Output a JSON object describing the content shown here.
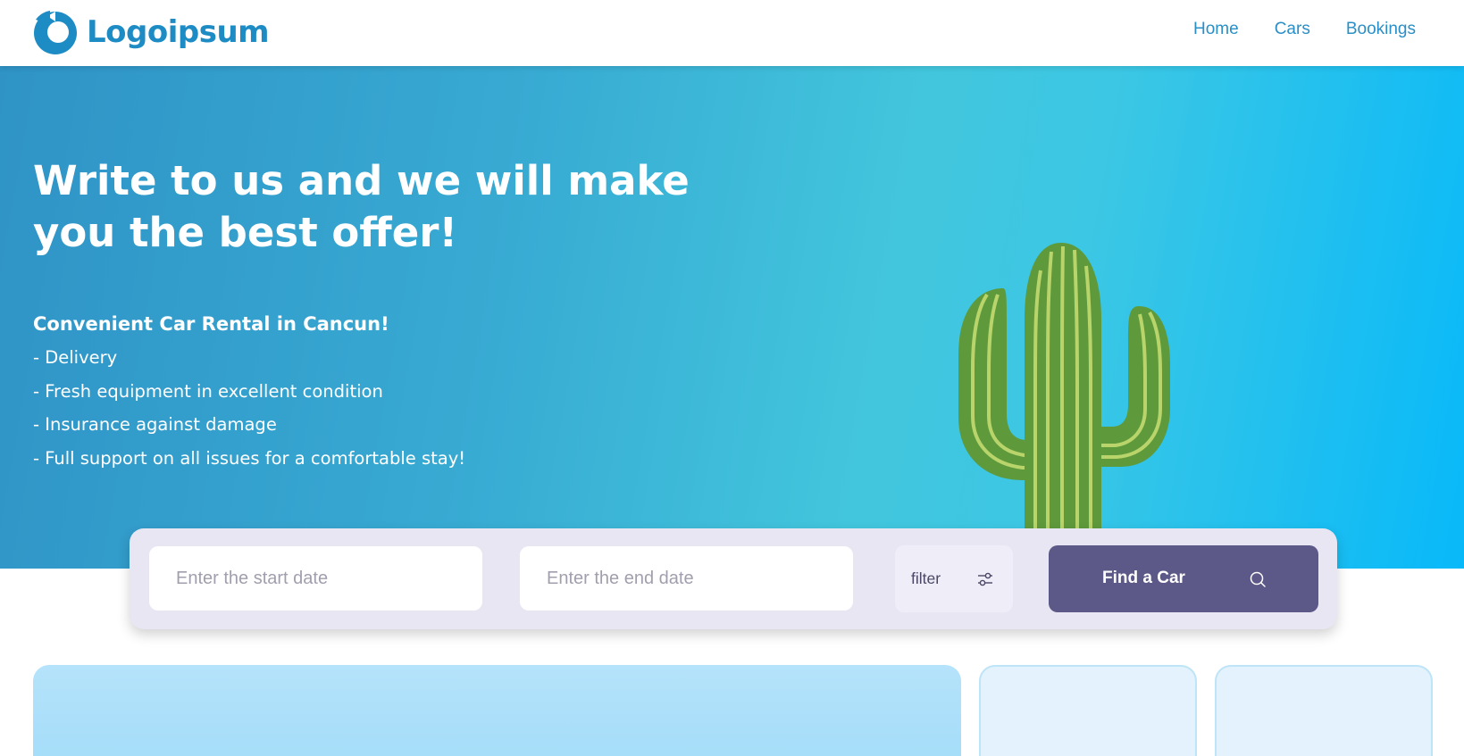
{
  "header": {
    "logo_text": "Logoipsum",
    "logo_icon": "logo-mark-icon",
    "brand_color": "#1e8cc4",
    "nav": [
      {
        "label": "Home"
      },
      {
        "label": "Cars"
      },
      {
        "label": "Bookings"
      }
    ]
  },
  "hero": {
    "title": "Write to us and we will make you the best offer!",
    "subtitle": "Convenient Car Rental in Cancun!",
    "features": [
      "- Delivery",
      "- Fresh equipment in excellent condition",
      "- Insurance against damage",
      "- Full support on all issues for a comfortable stay!"
    ],
    "illustration": "cactus-icon"
  },
  "search": {
    "start_placeholder": "Enter the start date",
    "end_placeholder": "Enter the end date",
    "filter_label": "filter",
    "filter_icon": "sliders-icon",
    "find_label": "Find a Car",
    "find_icon": "search-icon",
    "button_color": "#5c5887"
  }
}
